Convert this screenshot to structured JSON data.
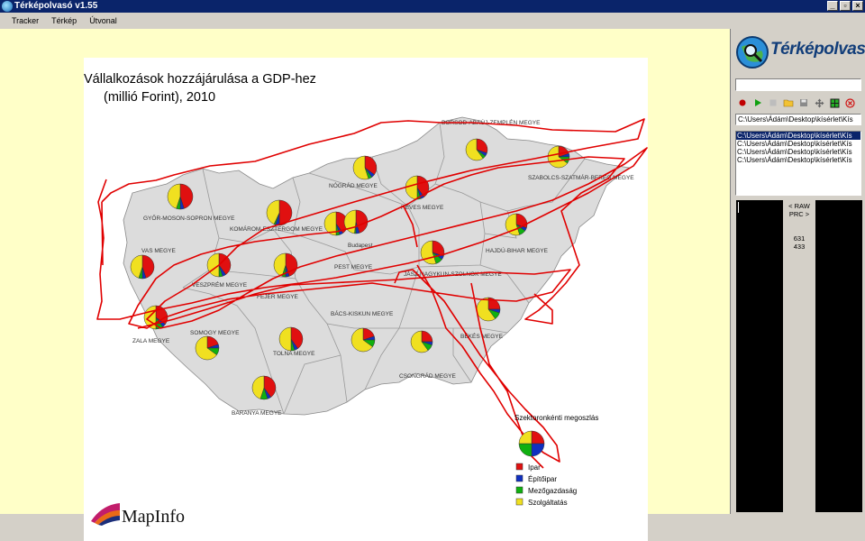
{
  "window": {
    "title": "Térképolvasó v1.55",
    "buttons": [
      "_",
      "▫",
      "×"
    ]
  },
  "menu": [
    "Tracker",
    "Térkép",
    "Útvonal"
  ],
  "map": {
    "title_line1": "Vállalkozások hozzájárulása a GDP-hez",
    "title_line2": "(millió Forint), 2010",
    "counties": [
      "BORSOD-ABAÚJ-ZEMPLÉN MEGYE",
      "SZABOLCS-SZATMÁR-BEREG MEGYE",
      "NÓGRÁD MEGYE",
      "HEVES MEGYE",
      "GYŐR-MOSON-SOPRON MEGYE",
      "KOMÁROM-ESZTERGOM MEGYE",
      "VAS MEGYE",
      "Budapest",
      "PEST MEGYE",
      "HAJDÚ-BIHAR MEGYE",
      "VESZPRÉM MEGYE",
      "FEJÉR MEGYE",
      "JÁSZ-NAGYKUN-SZOLNOK MEGYE",
      "ZALA MEGYE",
      "BÁCS-KISKUN MEGYE",
      "BÉKÉS MEGYE",
      "SOMOGY MEGYE",
      "TOLNA MEGYE",
      "CSONGRÁD MEGYE",
      "BARANYA MEGYE"
    ],
    "legend_title": "Szektoronkénti megoszlás",
    "legend_items": [
      {
        "label": "Ipar",
        "color": "#e01010"
      },
      {
        "label": "Építőipar",
        "color": "#1030c0"
      },
      {
        "label": "Mezőgazdaság",
        "color": "#10b010"
      },
      {
        "label": "Szolgáltatás",
        "color": "#f0e020"
      }
    ],
    "brand": "MapInfo"
  },
  "panel": {
    "logo_text": "Térképolvasó",
    "status_field": "",
    "path_field": "C:\\Users\\Ádám\\Desktop\\kísérlet\\Kís",
    "files": [
      "C:\\Users\\Ádám\\Desktop\\kísérlet\\Kís",
      "C:\\Users\\Ádám\\Desktop\\kísérlet\\Kís",
      "C:\\Users\\Ádám\\Desktop\\kísérlet\\Kís",
      "C:\\Users\\Ádám\\Desktop\\kísérlet\\Kís"
    ],
    "raw_label": "< RAW",
    "prc_label": "PRC >",
    "coord_x": "631",
    "coord_y": "433",
    "toolbar_icons": [
      "record-icon",
      "play-icon",
      "stop-icon",
      "open-folder-icon",
      "save-icon",
      "move-icon",
      "grid-icon",
      "close-icon"
    ]
  }
}
